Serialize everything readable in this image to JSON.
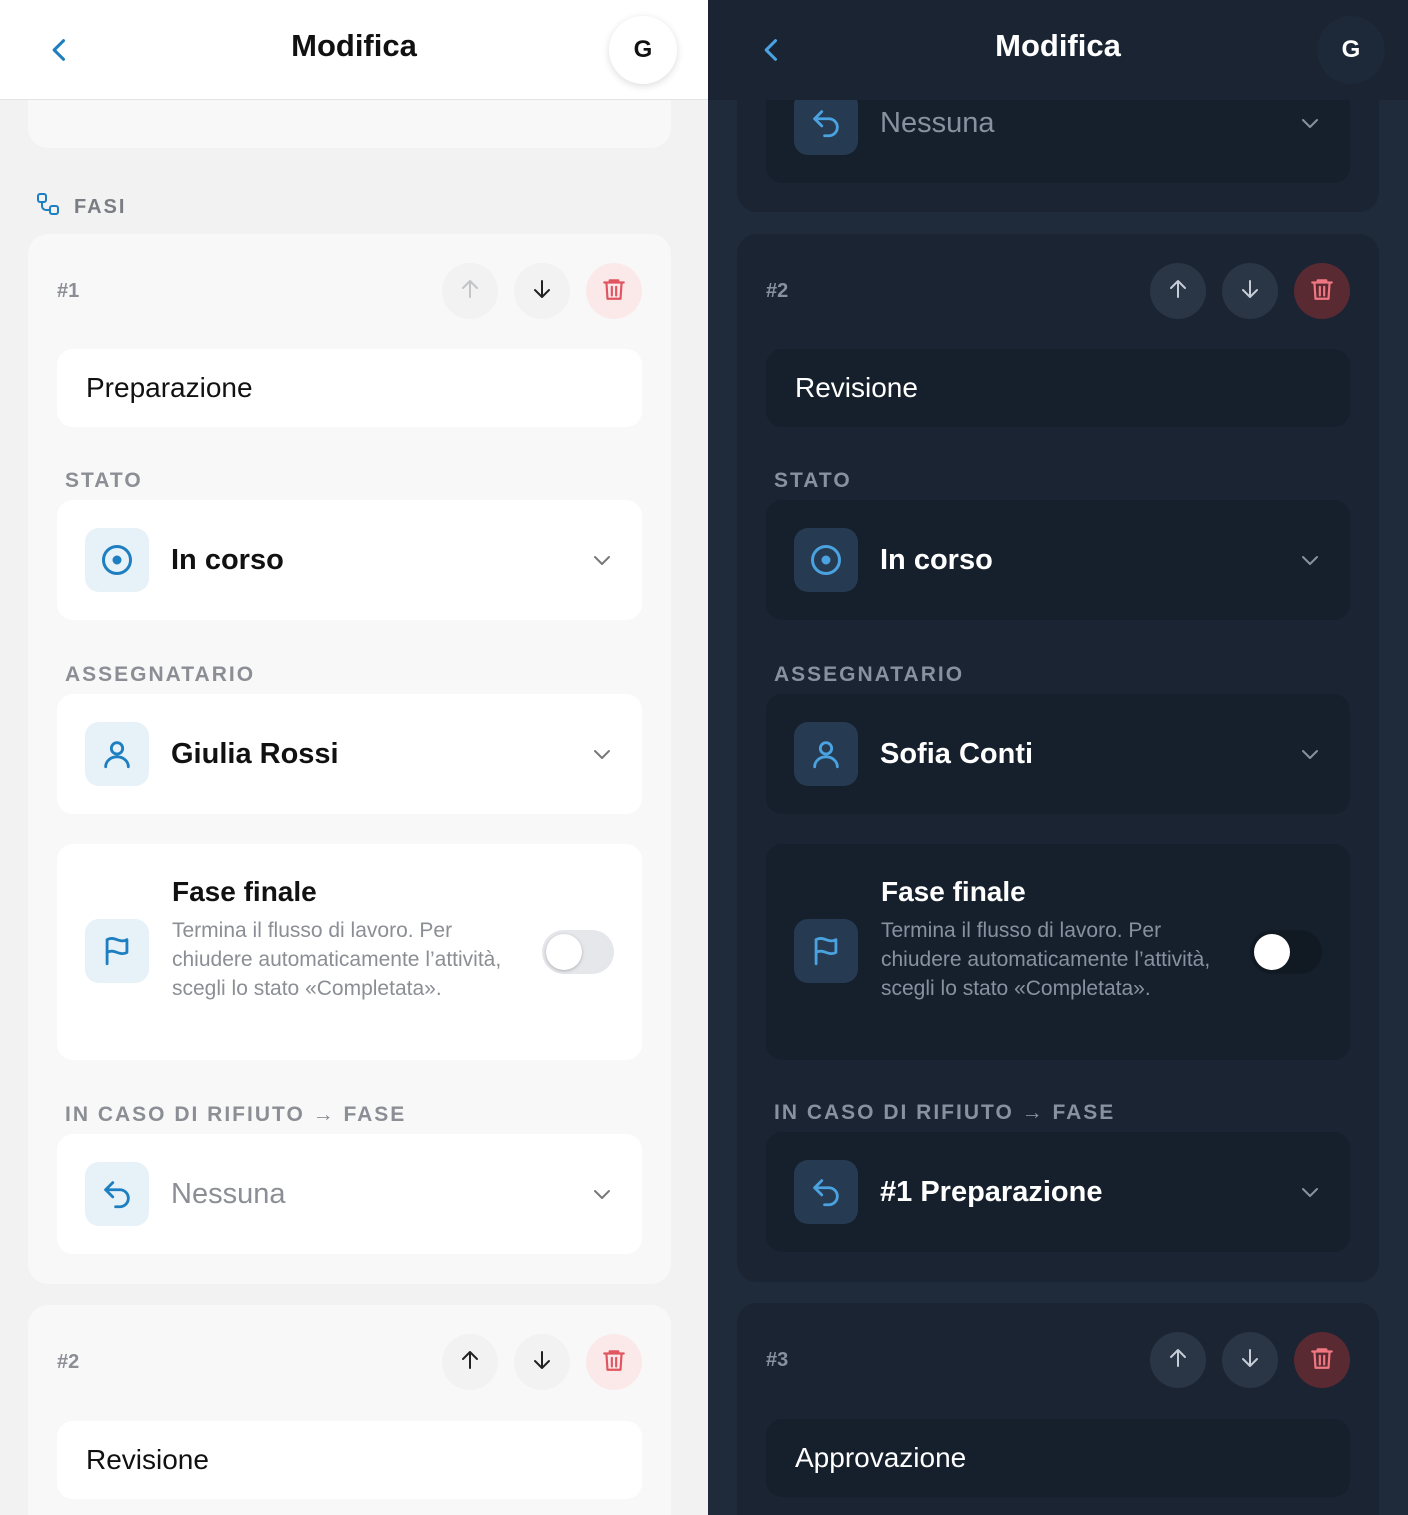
{
  "colors": {
    "accent": "#1d7fc1",
    "danger": "#e05560",
    "light_bg": "#f2f2f3",
    "dark_bg": "#1f2a3a"
  },
  "light": {
    "nav": {
      "title": "Modifica",
      "avatar": "G"
    },
    "section": {
      "title": "FASI"
    },
    "steps": [
      {
        "number": "#1",
        "name": "Preparazione",
        "state_label": "STATO",
        "state_value": "In corso",
        "assignee_label": "ASSEGNATARIO",
        "assignee_value": "Giulia Rossi",
        "final_title": "Fase finale",
        "final_desc": "Termina il flusso di lavoro. Per chiudere automaticamente l’attività, scegli lo stato «Completata».",
        "reject_label": "IN CASO DI RIFIUTO → FASE",
        "reject_value": "Nessuna"
      },
      {
        "number": "#2",
        "name": "Revisione"
      }
    ]
  },
  "dark": {
    "nav": {
      "title": "Modifica",
      "avatar": "G"
    },
    "prev_reject_value": "Nessuna",
    "steps": [
      {
        "number": "#2",
        "name": "Revisione",
        "state_label": "STATO",
        "state_value": "In corso",
        "assignee_label": "ASSEGNATARIO",
        "assignee_value": "Sofia Conti",
        "final_title": "Fase finale",
        "final_desc": "Termina il flusso di lavoro. Per chiudere automaticamente l’attività, scegli lo stato «Completata».",
        "reject_label": "IN CASO DI RIFIUTO → FASE",
        "reject_value": "#1 Preparazione"
      },
      {
        "number": "#3",
        "name": "Approvazione"
      }
    ]
  },
  "icons": {
    "back": "chevron-left-icon",
    "up": "arrow-up-icon",
    "down": "arrow-down-icon",
    "delete": "trash-icon",
    "state": "target-icon",
    "assignee": "user-icon",
    "final": "flag-icon",
    "reject": "undo-arrow-icon",
    "section": "workflow-icon",
    "dropdown": "chevron-down-icon"
  }
}
